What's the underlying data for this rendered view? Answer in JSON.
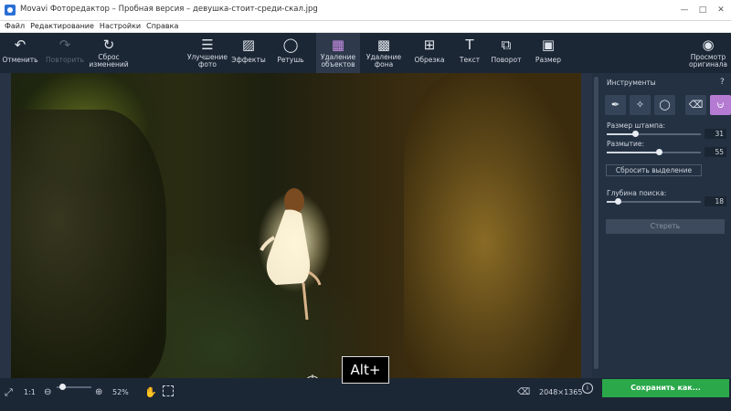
{
  "window": {
    "title": "Movavi Фоторедактор – Пробная версия – девушка-стоит-среди-скал.jpg",
    "minimize_icon": "minimize-icon",
    "maximize_icon": "maximize-icon",
    "close_icon": "close-icon"
  },
  "menu": [
    "Файл",
    "Редактирование",
    "Настройки",
    "Справка"
  ],
  "toolbar": {
    "undo": "Отменить",
    "redo": "Повторить",
    "reset_line1": "Сброс",
    "reset_line2": "изменений",
    "enhance_line1": "Улучшение",
    "enhance_line2": "фото",
    "effects": "Эффекты",
    "retouch": "Ретушь",
    "object_removal_line1": "Удаление",
    "object_removal_line2": "объектов",
    "bg_removal_line1": "Удаление",
    "bg_removal_line2": "фона",
    "crop": "Обрезка",
    "text": "Текст",
    "rotate": "Поворот",
    "resize": "Размер",
    "preview_line1": "Просмотр",
    "preview_line2": "оригинала"
  },
  "panel": {
    "title": "Инструменты",
    "help": "?",
    "tools": [
      "brush-icon",
      "magic-wand-icon",
      "lasso-icon",
      "eraser-icon",
      "clone-stamp-icon"
    ],
    "active_tool": "clone-stamp-icon",
    "stamp_size_label": "Размер штампа:",
    "stamp_size_value": "31",
    "blur_label": "Размытие:",
    "blur_value": "55",
    "reset_selection": "Сбросить выделение",
    "search_depth_label": "Глубина поиска:",
    "search_depth_value": "18",
    "erase_button": "Стереть"
  },
  "sliders": {
    "stamp_size_fraction": 0.3,
    "blur_fraction": 0.55,
    "search_depth_fraction": 0.12
  },
  "bottom": {
    "fit_icon": "fit-screen-icon",
    "one_to_one": "1:1",
    "zoom_out_icon": "zoom-out-icon",
    "zoom_in_icon": "zoom-in-icon",
    "zoom_value": "52%",
    "zoom_fraction": 0.15,
    "hand_icon": "hand-icon",
    "select_icon": "selection-icon",
    "trash_icon": "trash-icon",
    "dimensions": "2048×1365",
    "info_icon": "i",
    "save_button": "Сохранить как..."
  },
  "overlay": {
    "key_hint": "Alt+"
  },
  "colors": {
    "accent_active": "#b57bd3",
    "save_green": "#2aa84a",
    "toolbar_bg": "#1c2735"
  }
}
